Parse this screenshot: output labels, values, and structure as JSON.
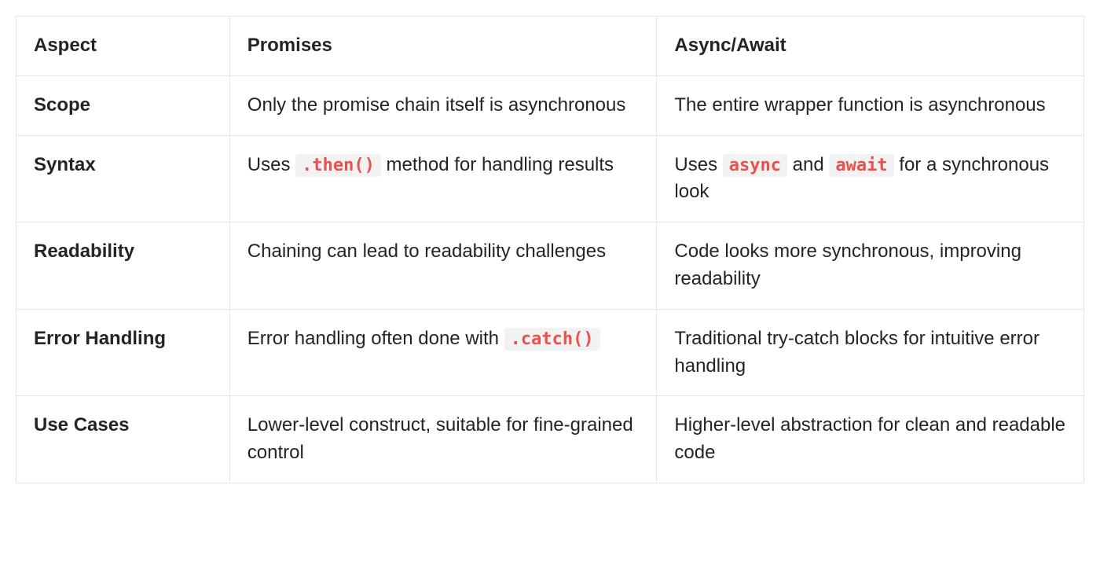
{
  "table": {
    "headers": [
      "Aspect",
      "Promises",
      "Async/Await"
    ],
    "rows": [
      {
        "aspect": "Scope",
        "promises": [
          {
            "text": "Only the promise chain itself is asynchronous"
          }
        ],
        "asyncawait": [
          {
            "text": "The entire wrapper function is asynchronous"
          }
        ]
      },
      {
        "aspect": "Syntax",
        "promises": [
          {
            "text": "Uses "
          },
          {
            "code": ".then()"
          },
          {
            "text": " method for handling results"
          }
        ],
        "asyncawait": [
          {
            "text": "Uses "
          },
          {
            "code": "async"
          },
          {
            "text": " and "
          },
          {
            "code": "await"
          },
          {
            "text": " for a synchronous look"
          }
        ]
      },
      {
        "aspect": "Readability",
        "promises": [
          {
            "text": "Chaining can lead to readability challenges"
          }
        ],
        "asyncawait": [
          {
            "text": "Code looks more synchronous, improving readability"
          }
        ]
      },
      {
        "aspect": "Error Handling",
        "promises": [
          {
            "text": "Error handling often done with "
          },
          {
            "code": ".catch()"
          }
        ],
        "asyncawait": [
          {
            "text": "Traditional try-catch blocks for intuitive error handling"
          }
        ]
      },
      {
        "aspect": "Use Cases",
        "promises": [
          {
            "text": "Lower-level construct, suitable for fine-grained control"
          }
        ],
        "asyncawait": [
          {
            "text": "Higher-level abstraction for clean and readable code"
          }
        ]
      }
    ]
  }
}
